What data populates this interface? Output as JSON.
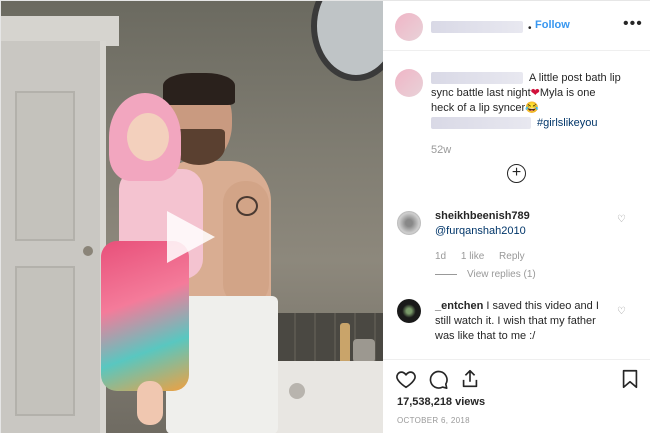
{
  "post": {
    "follow_label": "Follow",
    "dot": "•",
    "more": "•••",
    "caption": {
      "text_line1": "A little post bath lip",
      "text_line2": "sync battle last night",
      "heart": "❤",
      "text_line2b": "Myla is one",
      "text_line3": "heck of a lip syncer",
      "emoji": "😂",
      "hashtag": "#girlslikeyou"
    },
    "time_ago": "52w",
    "plus_icon": "+"
  },
  "comments": [
    {
      "username": "sheikhbeenish789",
      "mention": "@furqanshah2010",
      "time": "1d",
      "likes": "1 like",
      "reply": "Reply",
      "view_replies": "View replies (1)"
    },
    {
      "username": "_entchen",
      "text_after_user": "I saved this video and I",
      "text_line2": "still watch it. I wish that my father",
      "text_line3": "was like that to me :/"
    }
  ],
  "stats": {
    "views": "17,538,218 views",
    "date": "OCTOBER 6, 2018"
  },
  "icons": {
    "like": "heart-icon",
    "comment": "comment-icon",
    "share": "share-icon",
    "save": "bookmark-icon",
    "play": "play-icon"
  },
  "colors": {
    "accent": "#3897f0",
    "link": "#003569",
    "muted": "#999999",
    "heart": "#d0103a"
  }
}
